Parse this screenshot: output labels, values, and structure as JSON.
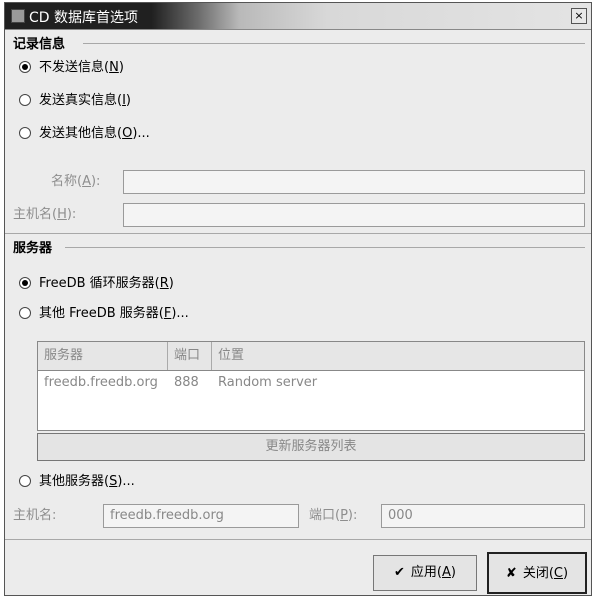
{
  "window": {
    "title": "CD 数据库首选项",
    "close_glyph": "×"
  },
  "info_section": {
    "title": "记录信息",
    "options": [
      {
        "text": "不发送信息(",
        "mnemonic": "N",
        "suffix": ")",
        "selected": true
      },
      {
        "text": "发送真实信息(",
        "mnemonic": "I",
        "suffix": ")",
        "selected": false
      },
      {
        "text": "发送其他信息(",
        "mnemonic": "O",
        "suffix": ")...",
        "selected": false
      }
    ],
    "name_label": "名称(",
    "name_mnemonic": "A",
    "name_suffix": "):",
    "name_value": "",
    "host_label": "主机名(",
    "host_mnemonic": "H",
    "host_suffix": "):",
    "host_value": ""
  },
  "server_section": {
    "title": "服务器",
    "options": [
      {
        "text": "FreeDB 循环服务器(",
        "mnemonic": "R",
        "suffix": ")",
        "selected": true
      },
      {
        "text": "其他 FreeDB 服务器(",
        "mnemonic": "F",
        "suffix": ")...",
        "selected": false
      }
    ],
    "table": {
      "headers": [
        "服务器",
        "端口",
        "位置"
      ],
      "rows": [
        [
          "freedb.freedb.org",
          "888",
          "Random server"
        ]
      ]
    },
    "update_button": "更新服务器列表",
    "other_option": {
      "text": "其他服务器(",
      "mnemonic": "S",
      "suffix": ")...",
      "selected": false
    },
    "host_label": "主机名:",
    "host_value": "freedb.freedb.org",
    "port_label": "端口(",
    "port_mnemonic": "P",
    "port_suffix": "):",
    "port_value": "000"
  },
  "buttons": {
    "apply_icon": "✔",
    "apply_label": "应用(",
    "apply_mnemonic": "A",
    "apply_suffix": ")",
    "close_icon": "✘",
    "close_label": "关闭(",
    "close_mnemonic": "C",
    "close_suffix": ")"
  }
}
